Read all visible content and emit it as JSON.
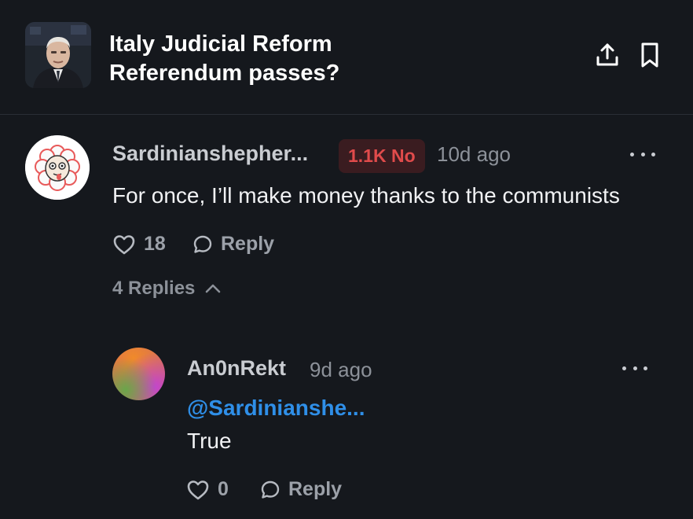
{
  "market": {
    "title": "Italy Judicial Reform Referendum passes?",
    "thumbnail": "portrait-of-man-photo"
  },
  "header": {
    "share_icon": "share-upload-icon",
    "bookmark_icon": "bookmark-icon"
  },
  "comment": {
    "username": "Sardinianshepher...",
    "position_badge": "1.1K No",
    "timestamp": "10d ago",
    "text": "For once, I’ll make money thanks to the communists",
    "likes": "18",
    "reply_label": "Reply",
    "replies_toggle": "4 Replies",
    "avatar": "sheep-avatar"
  },
  "reply": {
    "username": "An0nRekt",
    "timestamp": "9d ago",
    "mention": "@Sardinianshe...",
    "text": "True",
    "likes": "0",
    "reply_label": "Reply"
  },
  "colors": {
    "background": "#15181d",
    "no_badge_text": "#e04b4b",
    "no_badge_bg": "#3a1c20",
    "mention": "#2f8fe8"
  }
}
